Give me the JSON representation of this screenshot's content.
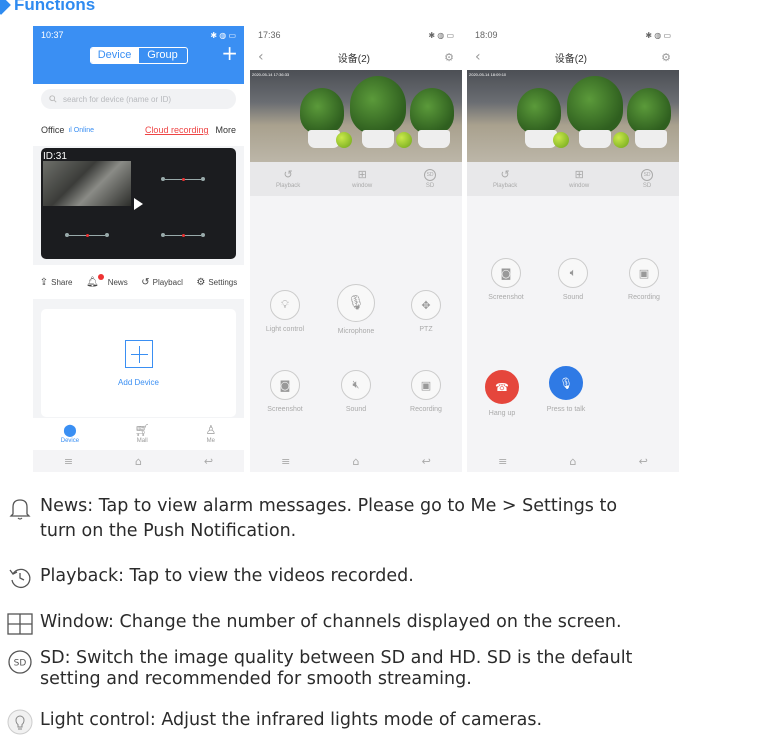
{
  "section_title": "Functions",
  "phone1": {
    "status": {
      "time": "10:37",
      "right": "✱ ◍ ▭"
    },
    "tabs": {
      "device": "Device",
      "group": "Group"
    },
    "plus_icon": "+",
    "search_placeholder": "search for device (name or ID)",
    "device_name": "Office",
    "online_label": "Online",
    "cloud_recording": "Cloud recording",
    "more": "More",
    "camera_id": "ID:31",
    "actions": {
      "share": "Share",
      "news": "News",
      "playback": "Playbacl",
      "settings": "Settings"
    },
    "add_device": "Add Device",
    "tabbar": {
      "device": "Device",
      "mall": "Mall",
      "me": "Me"
    }
  },
  "phone2": {
    "status": {
      "time": "17:36",
      "right": "✱ ◍ ▭"
    },
    "title": "设备(2)",
    "video_timestamp": "2020-05-14 17:36:33",
    "tools": {
      "playback": "Playback",
      "window": "window",
      "sd": "SD"
    },
    "controls": {
      "light": "Light control",
      "microphone": "Microphone",
      "ptz": "PTZ",
      "screenshot": "Screenshot",
      "sound": "Sound",
      "recording": "Recording"
    }
  },
  "phone3": {
    "status": {
      "time": "18:09",
      "right": "✱ ◍ ▭"
    },
    "title": "设备(2)",
    "video_timestamp": "2020-05-14 18:09:10",
    "tools": {
      "playback": "Playback",
      "window": "window",
      "sd": "SD"
    },
    "controls": {
      "screenshot": "Screenshot",
      "sound": "Sound",
      "recording": "Recording",
      "hang_up": "Hang up",
      "press_to_talk": "Press to talk"
    }
  },
  "legend": {
    "news_line1": "News: Tap to view alarm messages. Please go to Me > Settings to",
    "news_line2": "turn on the Push Notification.",
    "playback": "Playback: Tap to view the videos recorded.",
    "window": "Window: Change the number of channels displayed on the screen.",
    "sd_line1": "SD: Switch the image quality between SD and HD. SD is the default",
    "sd_line2": "setting and recommended for smooth streaming.",
    "light": "Light control: Adjust the infrared lights mode of cameras."
  },
  "icons": [
    "bell-icon",
    "playback-icon",
    "window-grid-icon",
    "sd-icon",
    "lightbulb-icon"
  ],
  "colors": {
    "accent": "#3a8ff3",
    "title": "#2f8bf0",
    "hangup": "#e5463c",
    "talk": "#2f7ae5"
  }
}
